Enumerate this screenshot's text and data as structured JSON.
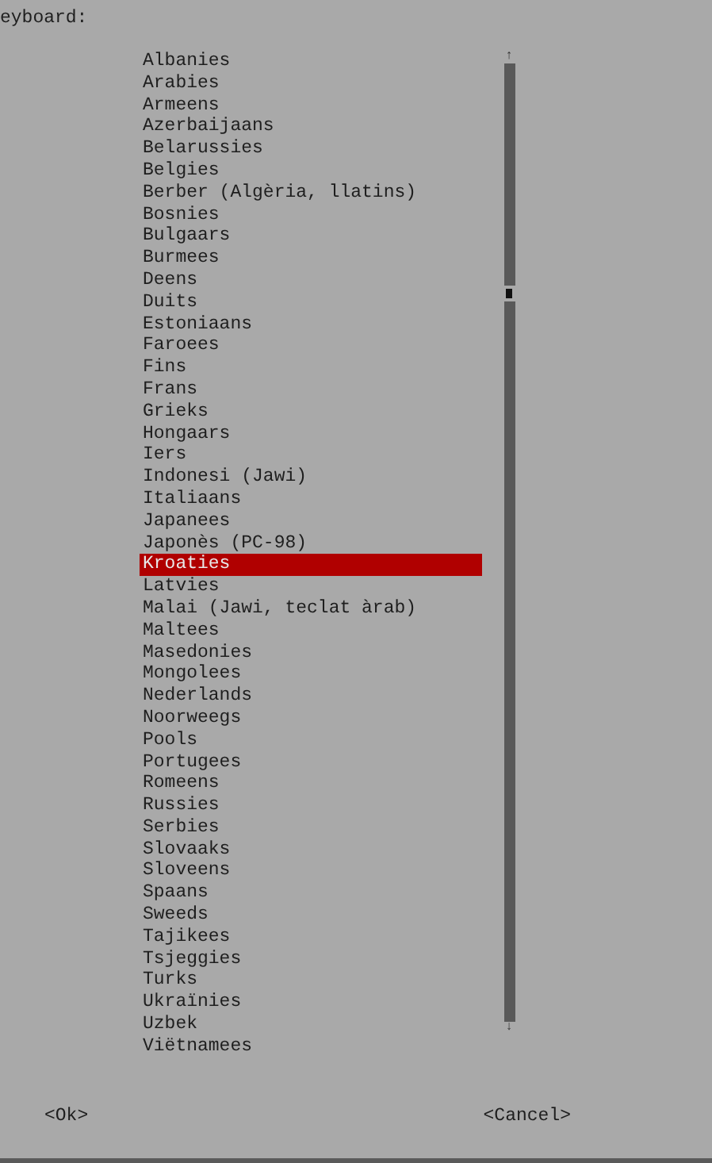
{
  "title": "eyboard:",
  "list": {
    "items": [
      {
        "label": "Albanies",
        "selected": false
      },
      {
        "label": "Arabies",
        "selected": false
      },
      {
        "label": "Armeens",
        "selected": false
      },
      {
        "label": "Azerbaijaans",
        "selected": false
      },
      {
        "label": "Belarussies",
        "selected": false
      },
      {
        "label": "Belgies",
        "selected": false
      },
      {
        "label": "Berber (Algèria, llatins)",
        "selected": false
      },
      {
        "label": "Bosnies",
        "selected": false
      },
      {
        "label": "Bulgaars",
        "selected": false
      },
      {
        "label": "Burmees",
        "selected": false
      },
      {
        "label": "Deens",
        "selected": false
      },
      {
        "label": "Duits",
        "selected": false
      },
      {
        "label": "Estoniaans",
        "selected": false
      },
      {
        "label": "Faroees",
        "selected": false
      },
      {
        "label": "Fins",
        "selected": false
      },
      {
        "label": "Frans",
        "selected": false
      },
      {
        "label": "Grieks",
        "selected": false
      },
      {
        "label": "Hongaars",
        "selected": false
      },
      {
        "label": "Iers",
        "selected": false
      },
      {
        "label": "Indonesi (Jawi)",
        "selected": false
      },
      {
        "label": "Italiaans",
        "selected": false
      },
      {
        "label": "Japanees",
        "selected": false
      },
      {
        "label": "Japonès (PC-98)",
        "selected": false
      },
      {
        "label": "Kroaties",
        "selected": true
      },
      {
        "label": "Latvies",
        "selected": false
      },
      {
        "label": "Malai (Jawi, teclat àrab)",
        "selected": false
      },
      {
        "label": "Maltees",
        "selected": false
      },
      {
        "label": "Masedonies",
        "selected": false
      },
      {
        "label": "Mongolees",
        "selected": false
      },
      {
        "label": "Nederlands",
        "selected": false
      },
      {
        "label": "Noorweegs",
        "selected": false
      },
      {
        "label": "Pools",
        "selected": false
      },
      {
        "label": "Portugees",
        "selected": false
      },
      {
        "label": "Romeens",
        "selected": false
      },
      {
        "label": "Russies",
        "selected": false
      },
      {
        "label": "Serbies",
        "selected": false
      },
      {
        "label": "Slovaaks",
        "selected": false
      },
      {
        "label": "Sloveens",
        "selected": false
      },
      {
        "label": "Spaans",
        "selected": false
      },
      {
        "label": "Sweeds",
        "selected": false
      },
      {
        "label": "Tajikees",
        "selected": false
      },
      {
        "label": "Tsjeggies",
        "selected": false
      },
      {
        "label": "Turks",
        "selected": false
      },
      {
        "label": "Ukraïnies",
        "selected": false
      },
      {
        "label": "Uzbek",
        "selected": false
      },
      {
        "label": "Viëtnamees",
        "selected": false
      }
    ],
    "scroll_up": "↑",
    "scroll_down": "↓"
  },
  "buttons": [
    "<Ok>",
    "<Cancel>"
  ]
}
